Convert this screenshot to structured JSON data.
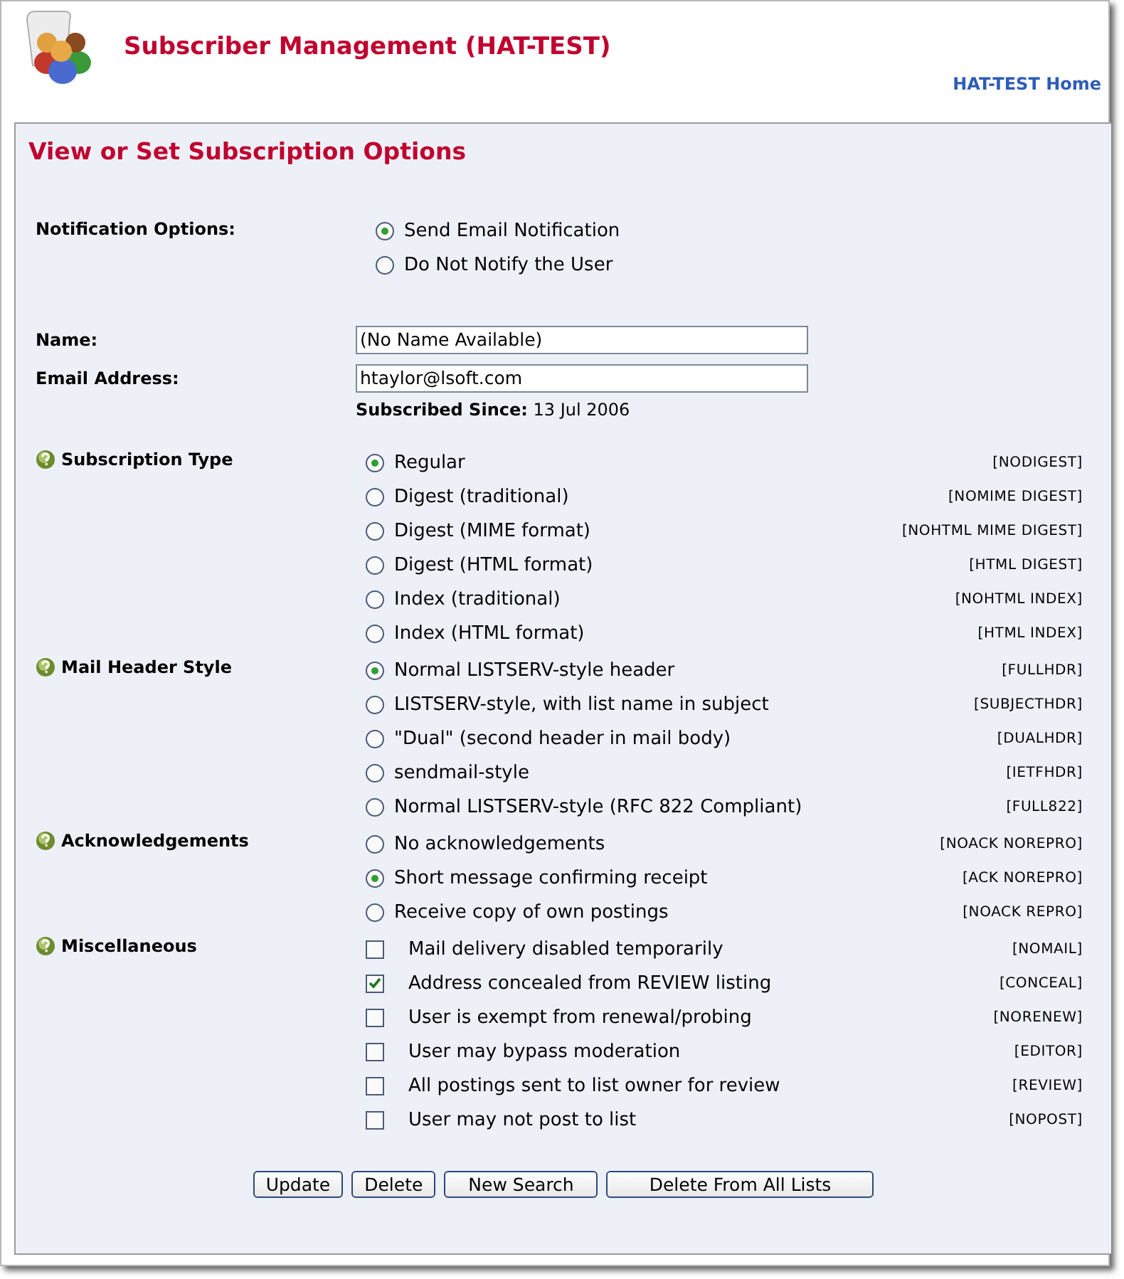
{
  "header": {
    "title": "Subscriber Management (HAT-TEST)",
    "home_link": "HAT-TEST Home"
  },
  "panel": {
    "title": "View or Set Subscription Options"
  },
  "notification": {
    "label": "Notification Options:",
    "options": [
      {
        "label": "Send Email Notification",
        "selected": true
      },
      {
        "label": "Do Not Notify the User",
        "selected": false
      }
    ]
  },
  "fields": [
    {
      "label": "Name:",
      "value": "(No Name Available)"
    },
    {
      "label": "Email Address:",
      "value": "htaylor@lsoft.com"
    }
  ],
  "subscribed_since": {
    "label": "Subscribed Since:",
    "value": "13 Jul 2006"
  },
  "groups": [
    {
      "label": "Subscription Type",
      "kind": "radio",
      "options": [
        {
          "label": "Regular",
          "code": "[NODIGEST]",
          "selected": true
        },
        {
          "label": "Digest (traditional)",
          "code": "[NOMIME DIGEST]",
          "selected": false
        },
        {
          "label": "Digest (MIME format)",
          "code": "[NOHTML MIME DIGEST]",
          "selected": false
        },
        {
          "label": "Digest (HTML format)",
          "code": "[HTML DIGEST]",
          "selected": false
        },
        {
          "label": "Index (traditional)",
          "code": "[NOHTML INDEX]",
          "selected": false
        },
        {
          "label": "Index (HTML format)",
          "code": "[HTML INDEX]",
          "selected": false
        }
      ]
    },
    {
      "label": "Mail Header Style",
      "kind": "radio",
      "options": [
        {
          "label": "Normal LISTSERV-style header",
          "code": "[FULLHDR]",
          "selected": true
        },
        {
          "label": "LISTSERV-style, with list name in subject",
          "code": "[SUBJECTHDR]",
          "selected": false
        },
        {
          "label": "\"Dual\" (second header in mail body)",
          "code": "[DUALHDR]",
          "selected": false
        },
        {
          "label": "sendmail-style",
          "code": "[IETFHDR]",
          "selected": false
        },
        {
          "label": "Normal LISTSERV-style (RFC 822 Compliant)",
          "code": "[FULL822]",
          "selected": false
        }
      ]
    },
    {
      "label": "Acknowledgements",
      "kind": "radio",
      "options": [
        {
          "label": "No acknowledgements",
          "code": "[NOACK NOREPRO]",
          "selected": false
        },
        {
          "label": "Short message confirming receipt",
          "code": "[ACK NOREPRO]",
          "selected": true
        },
        {
          "label": "Receive copy of own postings",
          "code": "[NOACK REPRO]",
          "selected": false
        }
      ]
    },
    {
      "label": "Miscellaneous",
      "kind": "checkbox",
      "options": [
        {
          "label": "Mail delivery disabled temporarily",
          "code": "[NOMAIL]",
          "checked": false
        },
        {
          "label": "Address concealed from REVIEW listing",
          "code": "[CONCEAL]",
          "checked": true
        },
        {
          "label": "User is exempt from renewal/probing",
          "code": "[NORENEW]",
          "checked": false
        },
        {
          "label": "User may bypass moderation",
          "code": "[EDITOR]",
          "checked": false
        },
        {
          "label": "All postings sent to list owner for review",
          "code": "[REVIEW]",
          "checked": false
        },
        {
          "label": "User may not post to list",
          "code": "[NOPOST]",
          "checked": false
        }
      ]
    }
  ],
  "buttons": [
    "Update",
    "Delete",
    "New Search",
    "Delete From All Lists"
  ]
}
